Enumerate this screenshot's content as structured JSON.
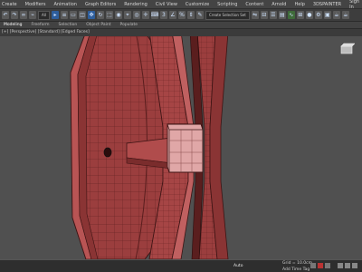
{
  "menu": {
    "items": [
      "Create",
      "Modifiers",
      "Animation",
      "Graph Editors",
      "Rendering",
      "Civil View",
      "Customize",
      "Scripting",
      "Content",
      "Arnold",
      "Help",
      "3DSPAINTER"
    ],
    "signin": "Sign In"
  },
  "toolbar": {
    "selection_filter": "All",
    "named_selection": "Create Selection Set"
  },
  "ribbon": {
    "tabs": [
      "Modeling",
      "Freeform",
      "Selection",
      "Object Paint",
      "Populate"
    ],
    "active_tab": "Modeling"
  },
  "viewport": {
    "label": "[+] [Perspective] [Standard] [Edged Faces]"
  },
  "status": {
    "coord": "Grid = 10.0cm",
    "add_time_tag": "Add Time Tag",
    "auto_key": "Auto",
    "set_key": "Set K."
  },
  "colors": {
    "model": "#a64545",
    "model_dark": "#7a2c2c",
    "model_light": "#c46a6a",
    "viewport_bg": "#505050"
  }
}
